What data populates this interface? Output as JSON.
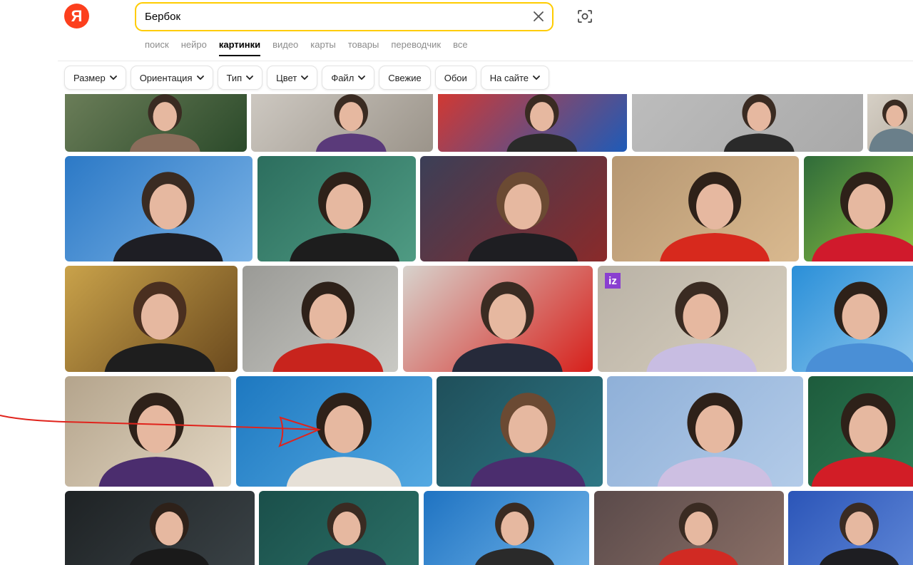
{
  "logo": {
    "letter": "Я",
    "icon": "yandex-logo-icon"
  },
  "search": {
    "query": "Бербок",
    "placeholder": ""
  },
  "tabs": [
    {
      "label": "поиск",
      "active": false
    },
    {
      "label": "нейро",
      "active": false
    },
    {
      "label": "картинки",
      "active": true
    },
    {
      "label": "видео",
      "active": false
    },
    {
      "label": "карты",
      "active": false
    },
    {
      "label": "товары",
      "active": false
    },
    {
      "label": "переводчик",
      "active": false
    },
    {
      "label": "все",
      "active": false
    }
  ],
  "filters": [
    {
      "label": "Размер",
      "dropdown": true
    },
    {
      "label": "Ориентация",
      "dropdown": true
    },
    {
      "label": "Тип",
      "dropdown": true
    },
    {
      "label": "Цвет",
      "dropdown": true
    },
    {
      "label": "Файл",
      "dropdown": true
    },
    {
      "label": "Свежие",
      "dropdown": false
    },
    {
      "label": "Обои",
      "dropdown": false
    },
    {
      "label": "На сайте",
      "dropdown": true
    }
  ],
  "badge": {
    "text": "iz"
  },
  "colors": {
    "brand": "#fc3f1d",
    "search_border": "#ffcc00",
    "annotation_arrow": "#e0231c"
  }
}
